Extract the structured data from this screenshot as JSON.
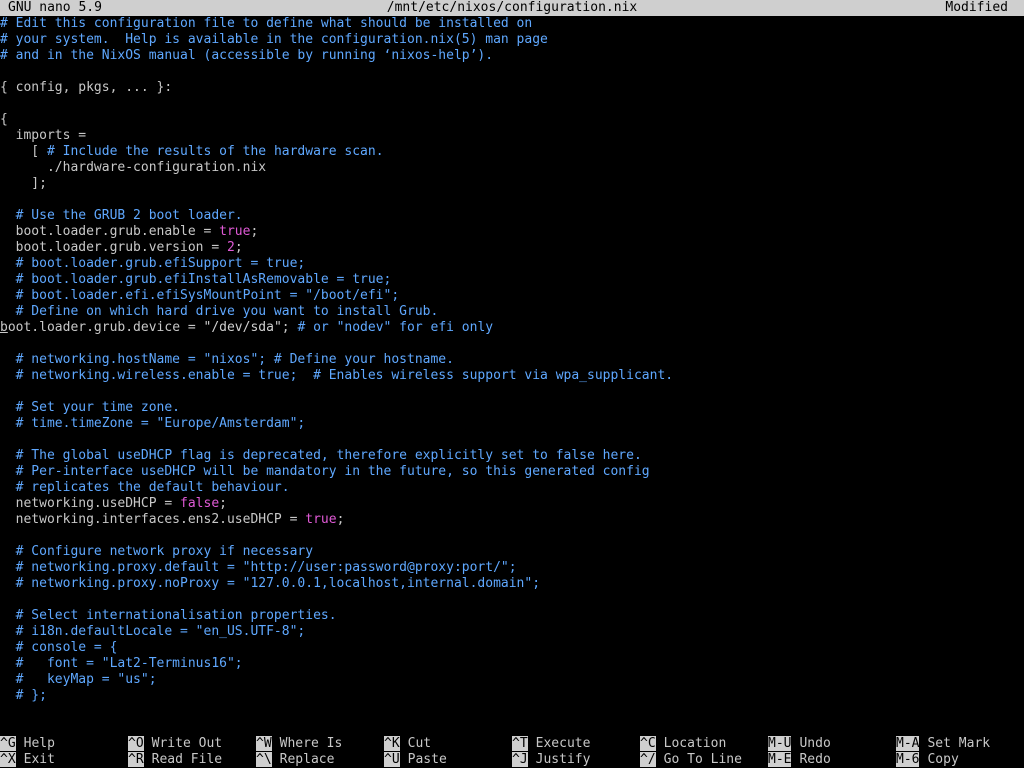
{
  "titlebar": {
    "app": "GNU nano 5.9",
    "file": "/mnt/etc/nixos/configuration.nix",
    "status": "Modified"
  },
  "lines": [
    "# Edit this configuration file to define what should be installed on",
    "# your system.  Help is available in the configuration.nix(5) man page",
    "# and in the NixOS manual (accessible by running ‘nixos-help’).",
    "",
    "{ config, pkgs, ... }:",
    "",
    "{",
    "  imports =",
    "    [ # Include the results of the hardware scan.",
    "      ./hardware-configuration.nix",
    "    ];",
    "",
    "  # Use the GRUB 2 boot loader.",
    "  boot.loader.grub.enable = true;",
    "  boot.loader.grub.version = 2;",
    "  # boot.loader.grub.efiSupport = true;",
    "  # boot.loader.grub.efiInstallAsRemovable = true;",
    "  # boot.loader.efi.efiSysMountPoint = \"/boot/efi\";",
    "  # Define on which hard drive you want to install Grub.",
    "boot.loader.grub.device = \"/dev/sda\"; # or \"nodev\" for efi only",
    "",
    "  # networking.hostName = \"nixos\"; # Define your hostname.",
    "  # networking.wireless.enable = true;  # Enables wireless support via wpa_supplicant.",
    "",
    "  # Set your time zone.",
    "  # time.timeZone = \"Europe/Amsterdam\";",
    "",
    "  # The global useDHCP flag is deprecated, therefore explicitly set to false here.",
    "  # Per-interface useDHCP will be mandatory in the future, so this generated config",
    "  # replicates the default behaviour.",
    "  networking.useDHCP = false;",
    "  networking.interfaces.ens2.useDHCP = true;",
    "",
    "  # Configure network proxy if necessary",
    "  # networking.proxy.default = \"http://user:password@proxy:port/\";",
    "  # networking.proxy.noProxy = \"127.0.0.1,localhost,internal.domain\";",
    "",
    "  # Select internationalisation properties.",
    "  # i18n.defaultLocale = \"en_US.UTF-8\";",
    "  # console = {",
    "  #   font = \"Lat2-Terminus16\";",
    "  #   keyMap = \"us\";",
    "  # };"
  ],
  "shortcuts": [
    {
      "key": "^G",
      "label": "Help"
    },
    {
      "key": "^X",
      "label": "Exit"
    },
    {
      "key": "^O",
      "label": "Write Out"
    },
    {
      "key": "^R",
      "label": "Read File"
    },
    {
      "key": "^W",
      "label": "Where Is"
    },
    {
      "key": "^\\",
      "label": "Replace"
    },
    {
      "key": "^K",
      "label": "Cut"
    },
    {
      "key": "^U",
      "label": "Paste"
    },
    {
      "key": "^T",
      "label": "Execute"
    },
    {
      "key": "^J",
      "label": "Justify"
    },
    {
      "key": "^C",
      "label": "Location"
    },
    {
      "key": "^/",
      "label": "Go To Line"
    },
    {
      "key": "M-U",
      "label": "Undo"
    },
    {
      "key": "M-E",
      "label": "Redo"
    },
    {
      "key": "M-A",
      "label": "Set Mark"
    },
    {
      "key": "M-6",
      "label": "Copy"
    }
  ],
  "colors": {
    "comment": "#5fa8ff",
    "keyword": "#e05ad6",
    "titlebar_bg": "#cfcfcf",
    "background": "#000000"
  }
}
